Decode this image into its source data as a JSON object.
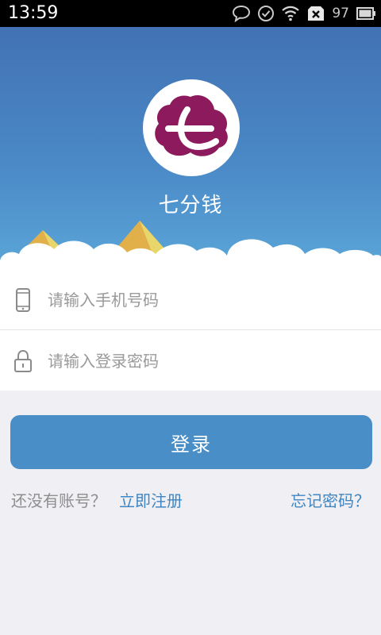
{
  "status_bar": {
    "time": "13:59",
    "battery_level": "97",
    "icons": [
      "chat-bubble-icon",
      "check-circle-icon",
      "wifi-icon",
      "sim-blocked-icon",
      "battery-icon"
    ]
  },
  "app": {
    "name": "七分钱",
    "logo_icon": "qifenqian-logo",
    "brand_color": "#8c1a5c",
    "sky_color": "#4272b4"
  },
  "form": {
    "phone": {
      "placeholder": "请输入手机号码",
      "value": "",
      "icon": "mobile-phone-icon"
    },
    "password": {
      "placeholder": "请输入登录密码",
      "value": "",
      "icon": "lock-icon"
    }
  },
  "actions": {
    "login_label": "登录",
    "login_color": "#4a8ec8",
    "no_account_text": "还没有账号？",
    "register_label": "立即注册",
    "forgot_label": "忘记密码？",
    "link_color": "#3f86c2"
  }
}
